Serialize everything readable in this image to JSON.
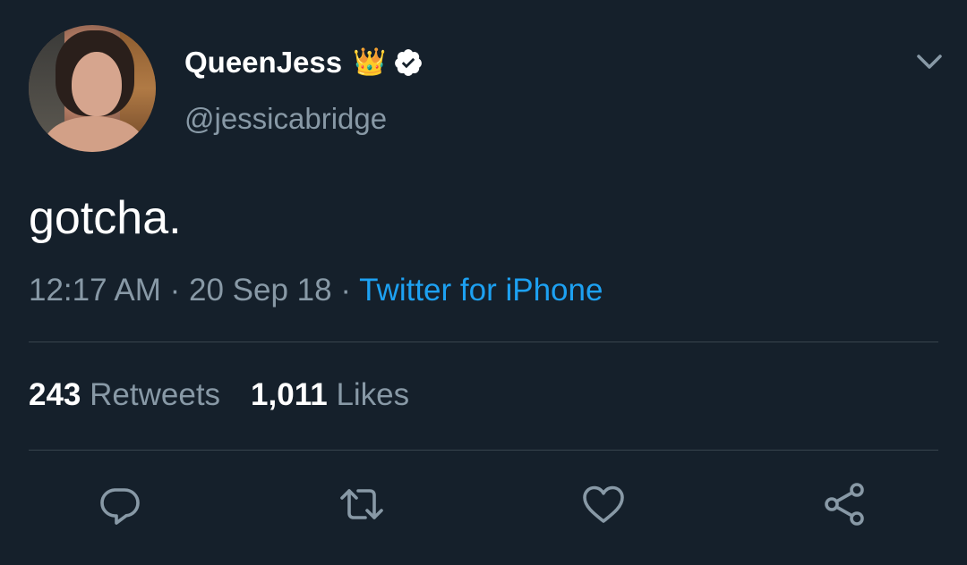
{
  "tweet": {
    "display_name": "QueenJess",
    "crown_emoji": "👑",
    "handle": "@jessicabridge",
    "text": "gotcha.",
    "time": "12:17 AM",
    "separator": "·",
    "date": "20 Sep 18",
    "source": "Twitter for iPhone"
  },
  "stats": {
    "retweets_count": "243",
    "retweets_label": "Retweets",
    "likes_count": "1,011",
    "likes_label": "Likes"
  },
  "actions": [
    {
      "icon": "reply-icon"
    },
    {
      "icon": "retweet-icon"
    },
    {
      "icon": "like-icon"
    },
    {
      "icon": "share-icon"
    }
  ],
  "colors": {
    "background": "#15202b",
    "primary_text": "#ffffff",
    "secondary_text": "#8899a6",
    "link": "#1da1f2",
    "divider": "#38444d"
  }
}
